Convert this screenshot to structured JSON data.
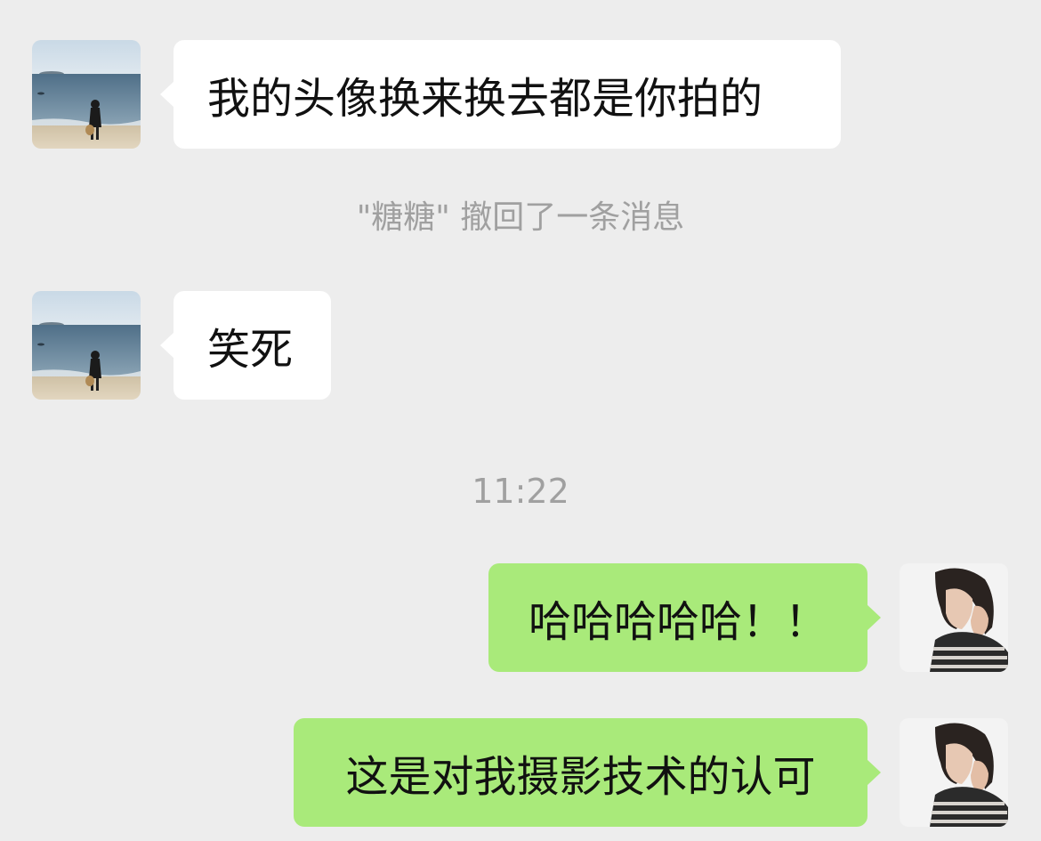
{
  "conversation": {
    "messages": [
      {
        "direction": "incoming",
        "text": "我的头像换来换去都是你拍的"
      },
      {
        "direction": "incoming",
        "text": "笑死"
      },
      {
        "direction": "outgoing",
        "text": "哈哈哈哈哈！！"
      },
      {
        "direction": "outgoing",
        "text": "这是对我摄影技术的认可"
      }
    ],
    "recall_notice": "\"糖糖\" 撤回了一条消息",
    "timestamp": "11:22"
  },
  "colors": {
    "background": "#ededed",
    "incoming_bubble": "#ffffff",
    "outgoing_bubble": "#a9ea7a",
    "system_text": "#a0a0a0"
  },
  "icons": {
    "incoming_avatar": "beach-photo-avatar",
    "outgoing_avatar": "portrait-photo-avatar"
  }
}
